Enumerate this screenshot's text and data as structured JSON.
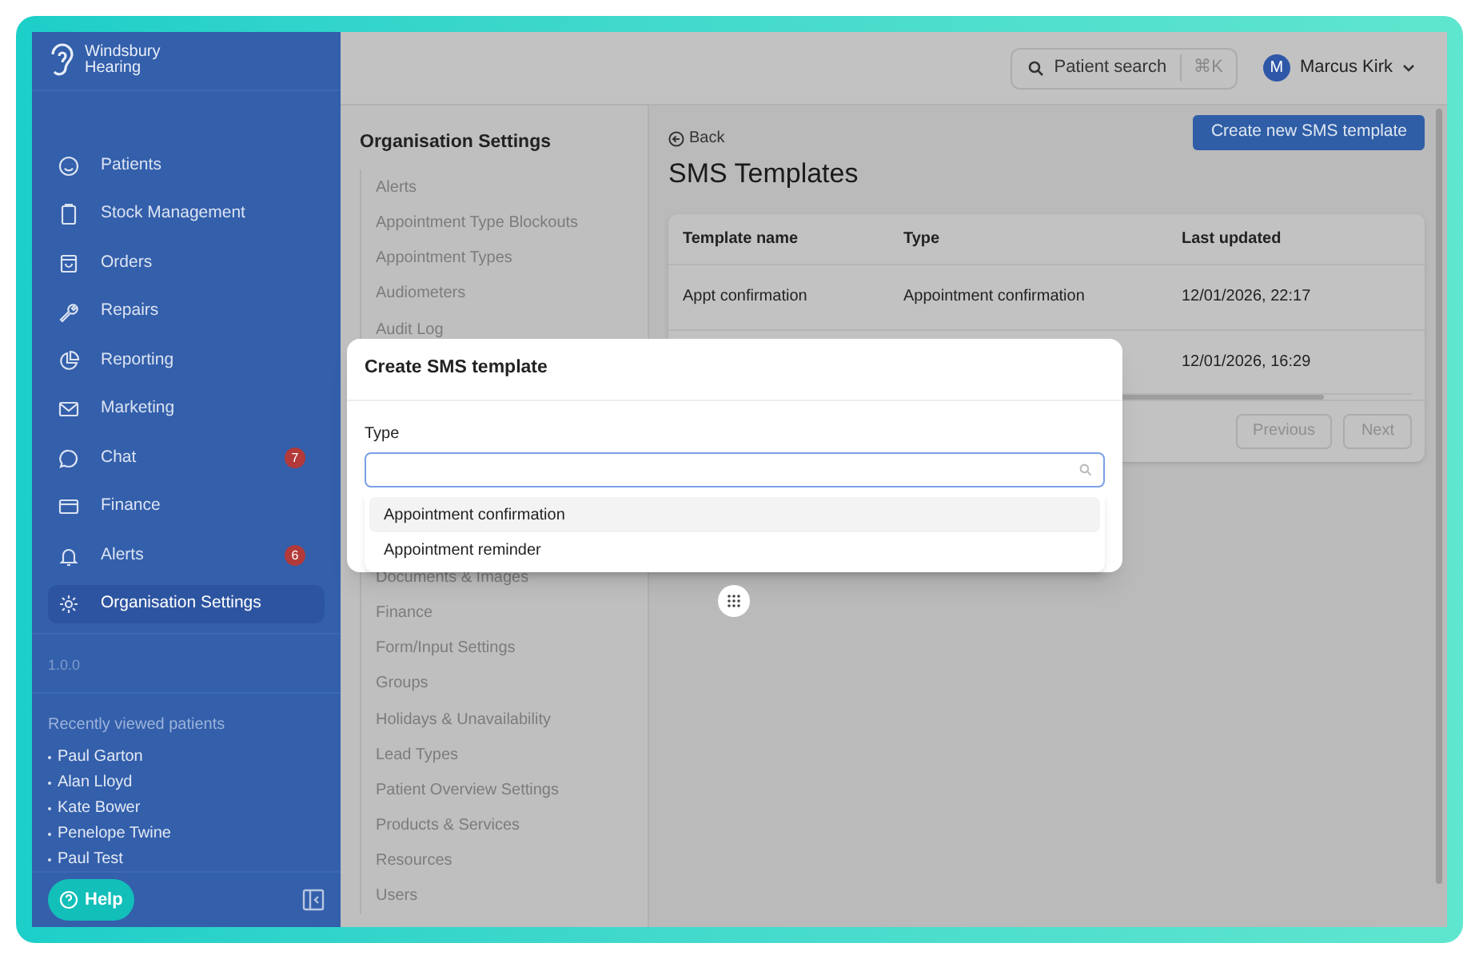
{
  "sidebar": {
    "brand": [
      "Windsbury",
      "Hearing"
    ],
    "nav": [
      {
        "label": "Patients",
        "selected": false
      },
      {
        "label": "Stock Management",
        "selected": false
      },
      {
        "label": "Orders",
        "selected": false
      },
      {
        "label": "Repairs",
        "selected": false
      },
      {
        "label": "Reporting",
        "selected": false
      },
      {
        "label": "Marketing",
        "selected": false
      },
      {
        "label": "Chat",
        "badge": "7",
        "selected": false
      },
      {
        "label": "Finance",
        "selected": false
      },
      {
        "label": "Alerts",
        "badge": "6",
        "selected": false
      },
      {
        "label": "Organisation Settings",
        "selected": true
      }
    ],
    "version": "1.0.0",
    "recent_title": "Recently viewed patients",
    "recent": [
      "Paul Garton",
      "Alan Lloyd",
      "Kate Bower",
      "Penelope Twine",
      "Paul Test"
    ],
    "help": "Help"
  },
  "topbar": {
    "search": "Patient search",
    "shortcut": "⌘K",
    "user_initial": "M",
    "user_name": "Marcus Kirk"
  },
  "settings_nav": {
    "title": "Organisation Settings",
    "items_top": [
      "Alerts",
      "Appointment Type Blockouts",
      "Appointment Types",
      "Audiometers",
      "Audit Log"
    ],
    "items_bottom": [
      "Documents & Images",
      "Finance",
      "Form/Input Settings",
      "Groups",
      "Holidays & Unavailability",
      "Lead Types",
      "Patient Overview Settings",
      "Products & Services",
      "Resources",
      "Users"
    ]
  },
  "page": {
    "back": "Back",
    "title": "SMS Templates",
    "create_button": "Create new SMS template",
    "columns": [
      "Template name",
      "Type",
      "Last updated"
    ],
    "rows": [
      {
        "template_name": "Appt confirmation",
        "type": "Appointment confirmation",
        "last_updated": "12/01/2026, 22:17"
      },
      {
        "last_updated": "12/01/2026, 16:29"
      }
    ],
    "pagination": [
      {
        "label": "Previous",
        "disabled": true
      },
      {
        "label": "Next",
        "disabled": true
      }
    ]
  },
  "modal": {
    "title": "Create SMS template",
    "field_label": "Type",
    "options": [
      {
        "label": "Appointment confirmation",
        "selected": true
      },
      {
        "label": "Appointment reminder",
        "selected": false
      }
    ]
  }
}
